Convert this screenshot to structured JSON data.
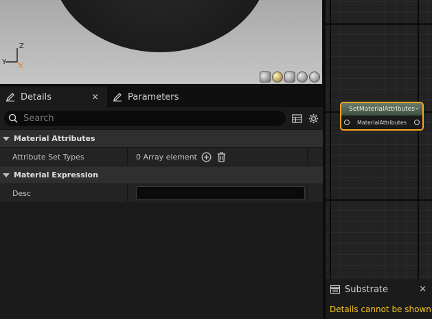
{
  "viewport": {
    "axis": {
      "z": "Z",
      "y": "Y",
      "x": "X"
    }
  },
  "tabs": [
    {
      "label": "Details",
      "close": "×"
    },
    {
      "label": "Parameters"
    }
  ],
  "search": {
    "placeholder": "Search"
  },
  "categories": [
    {
      "label": "Material Attributes",
      "rows": [
        {
          "name": "Attribute Set Types",
          "value": "0 Array element"
        }
      ]
    },
    {
      "label": "Material Expression",
      "rows": [
        {
          "name": "Desc",
          "value": ""
        }
      ]
    }
  ],
  "node": {
    "title": "SetMaterialAttributes",
    "pin_label": "MaterialAttributes",
    "chevron": "⌄"
  },
  "substrate": {
    "title": "Substrate",
    "close": "×",
    "message": "Details cannot be shown: S"
  },
  "colors": {
    "node_border": "#f5a623",
    "warning_text": "#f5c518",
    "accent_viewport": "#b5b5b5"
  }
}
